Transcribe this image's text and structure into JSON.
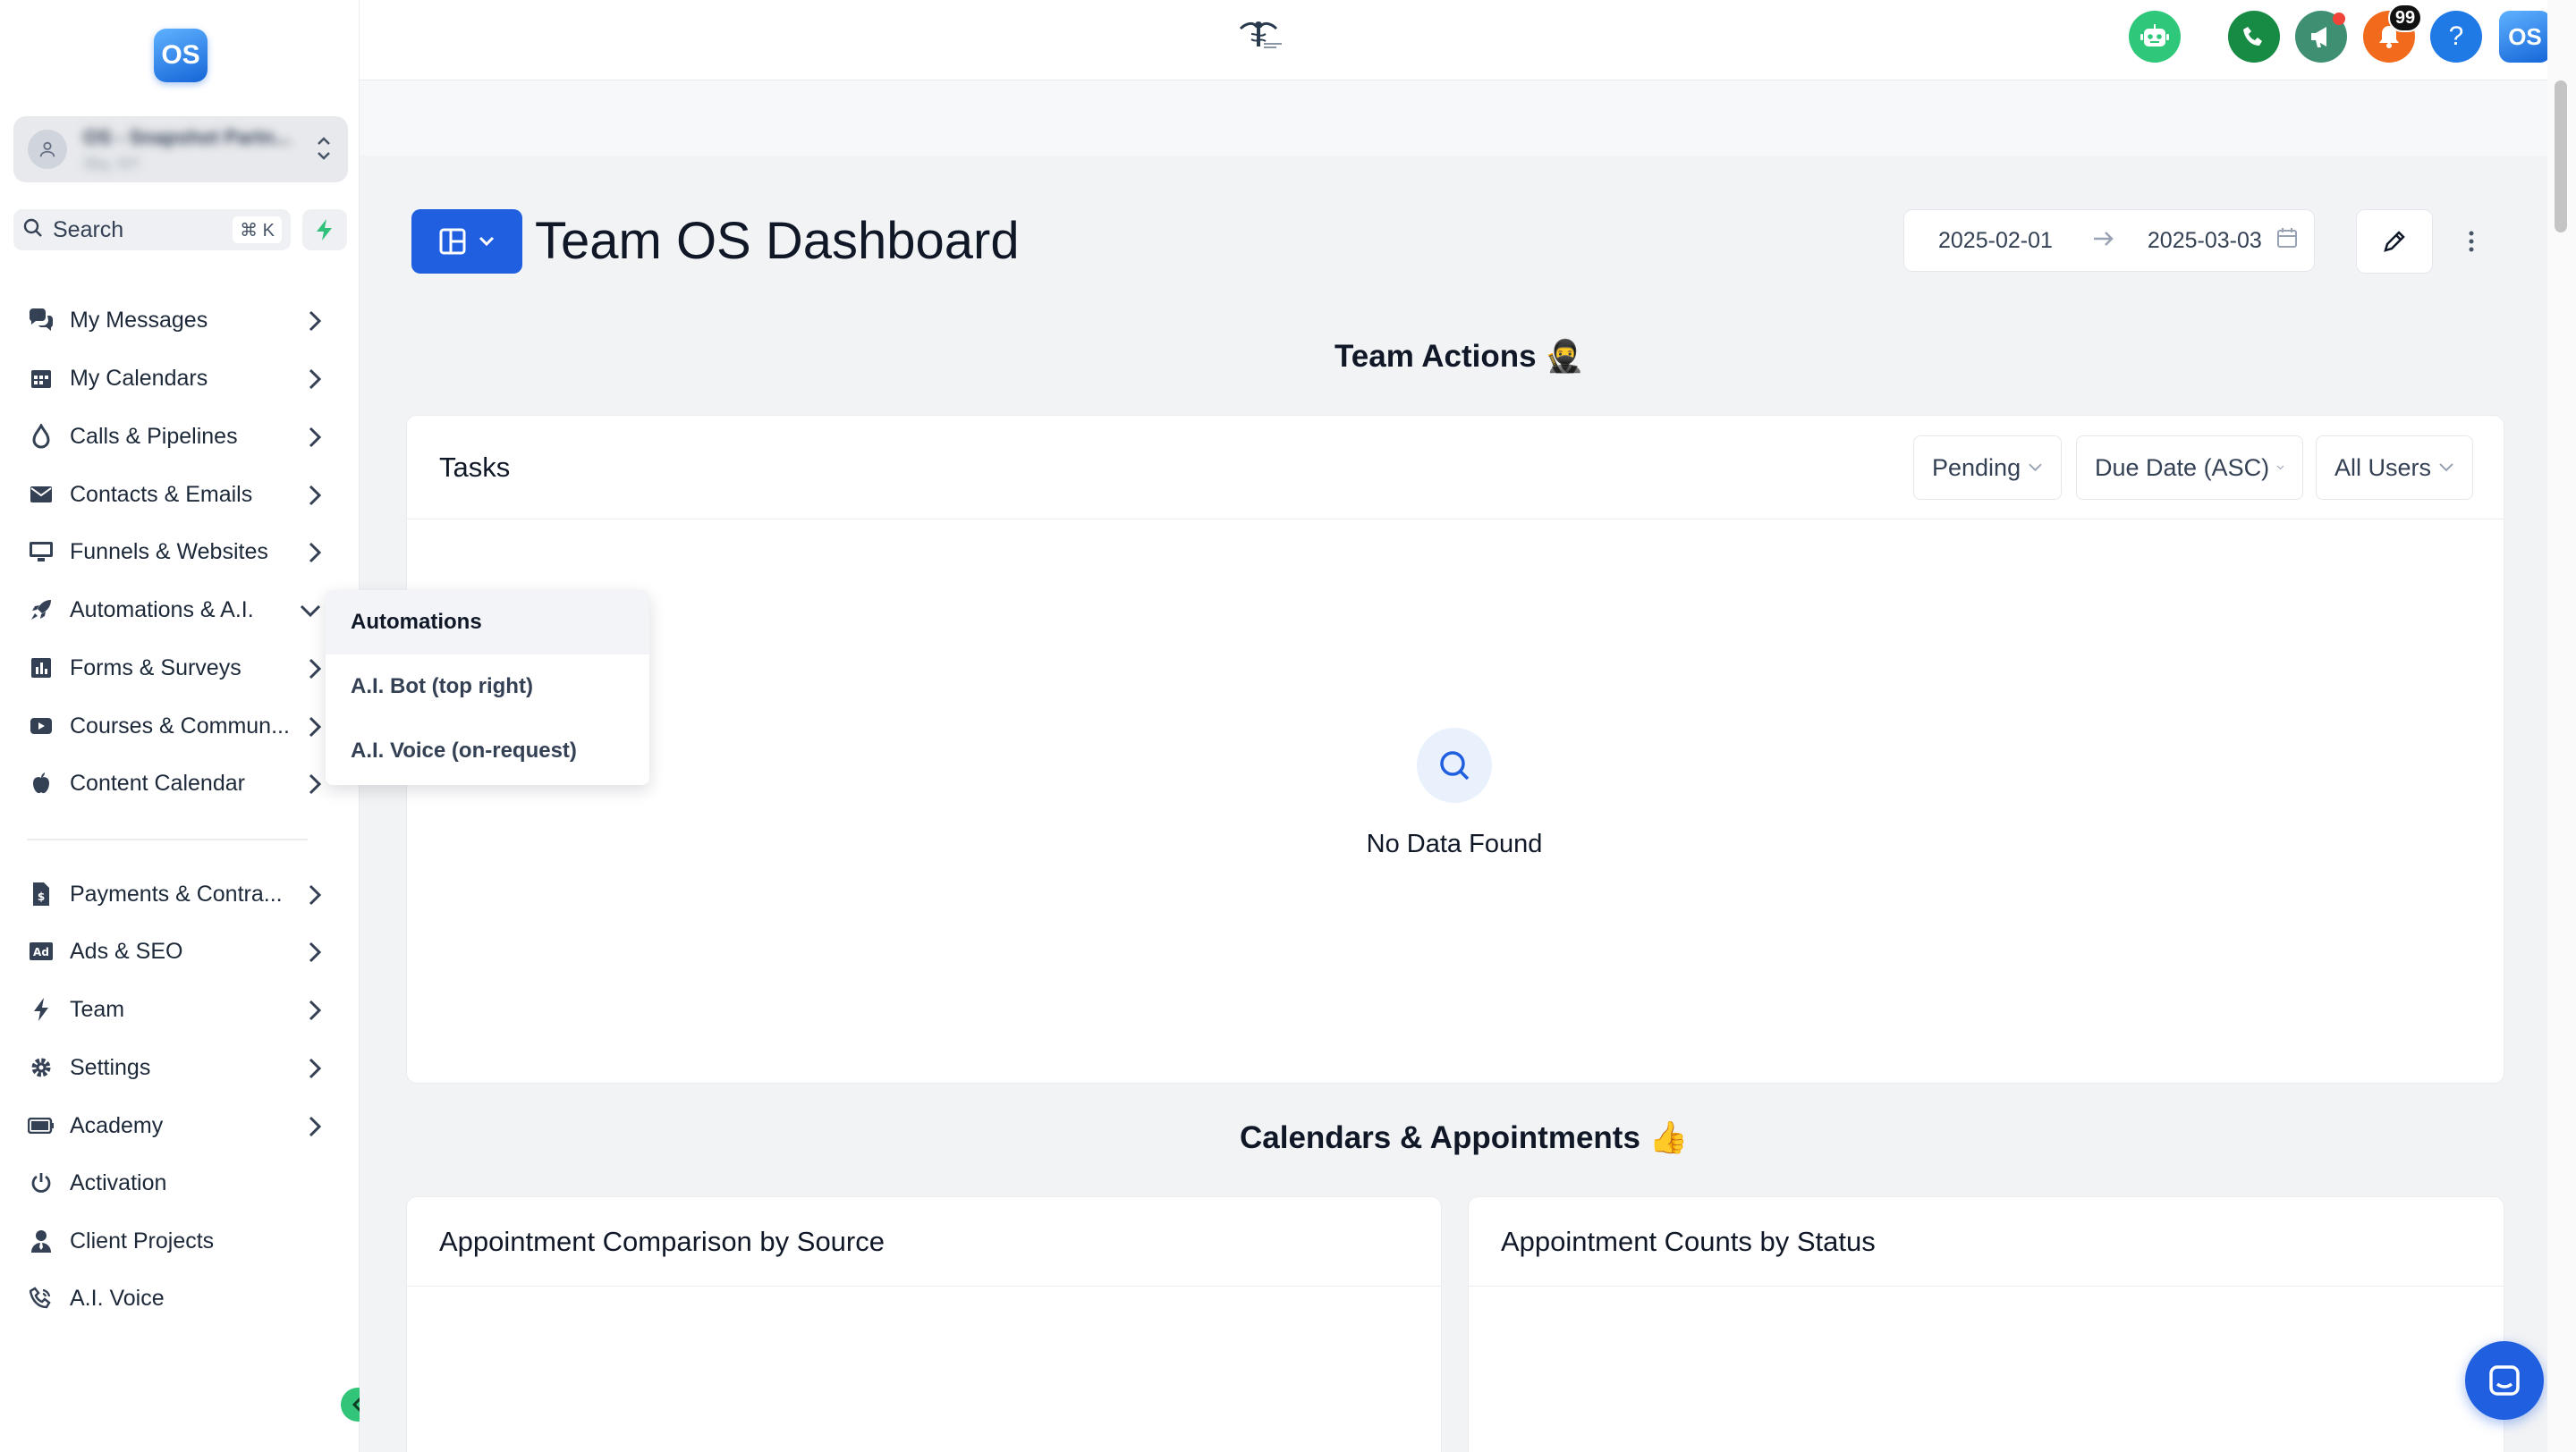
{
  "brand": {
    "logo_text": "OS",
    "accent": "#1f5fe0"
  },
  "sidebar": {
    "account": {
      "name": "OS - Snapshot Partn...",
      "sub": "Sky, NY"
    },
    "search": {
      "label": "Search",
      "shortcut": "⌘ K"
    },
    "items": [
      {
        "label": "My Messages",
        "icon": "chat-bubbles-icon"
      },
      {
        "label": "My Calendars",
        "icon": "calendar-icon"
      },
      {
        "label": "Calls & Pipelines",
        "icon": "drop-icon"
      },
      {
        "label": "Contacts & Emails",
        "icon": "envelope-icon"
      },
      {
        "label": "Funnels & Websites",
        "icon": "monitor-icon"
      },
      {
        "label": "Automations & A.I.",
        "icon": "rocket-icon"
      },
      {
        "label": "Forms & Surveys",
        "icon": "bar-chart-icon"
      },
      {
        "label": "Courses & Commun...",
        "icon": "play-icon"
      },
      {
        "label": "Content Calendar",
        "icon": "apple-icon"
      },
      {
        "label": "Payments & Contra...",
        "icon": "invoice-icon"
      },
      {
        "label": "Ads & SEO",
        "icon": "ad-icon"
      },
      {
        "label": "Team",
        "icon": "bolt-icon"
      },
      {
        "label": "Settings",
        "icon": "gear-icon"
      },
      {
        "label": "Academy",
        "icon": "battery-icon"
      },
      {
        "label": "Activation",
        "icon": "power-icon"
      },
      {
        "label": "Client Projects",
        "icon": "user-tie-icon"
      },
      {
        "label": "A.I. Voice",
        "icon": "phone-volume-icon"
      }
    ]
  },
  "submenu": {
    "items": [
      {
        "label": "Automations"
      },
      {
        "label": "A.I. Bot (top right)"
      },
      {
        "label": "A.I. Voice (on-request)"
      }
    ]
  },
  "topbar": {
    "notification_count": "99",
    "help_label": "?",
    "profile_text": "OS"
  },
  "dashboard": {
    "title": "Team OS Dashboard",
    "date_start": "2025-02-01",
    "date_end": "2025-03-03",
    "team_actions_title": "Team Actions 🥷",
    "tasks": {
      "title": "Tasks",
      "filter_status": "Pending",
      "filter_sort": "Due Date (ASC)",
      "filter_users": "All Users",
      "empty": "No Data Found"
    },
    "calendars_title": "Calendars & Appointments 👍",
    "card_source": "Appointment Comparison by Source",
    "card_status": "Appointment Counts by Status"
  }
}
